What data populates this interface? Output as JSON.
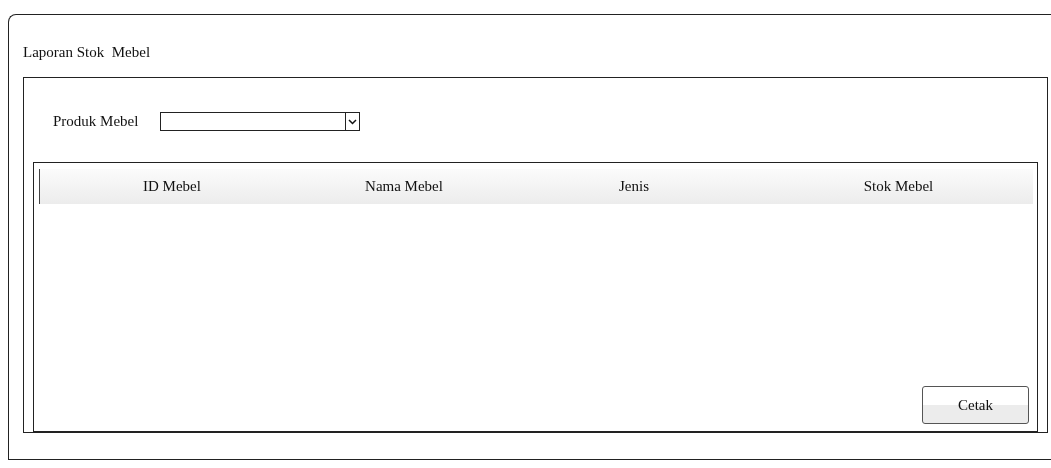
{
  "window": {
    "title": "Laporan Stok  Mebel"
  },
  "filter": {
    "label": "Produk Mebel"
  },
  "table": {
    "columns": [
      "ID Mebel",
      "Nama Mebel",
      "Jenis",
      "Stok Mebel"
    ]
  },
  "buttons": [
    "Cetak"
  ]
}
